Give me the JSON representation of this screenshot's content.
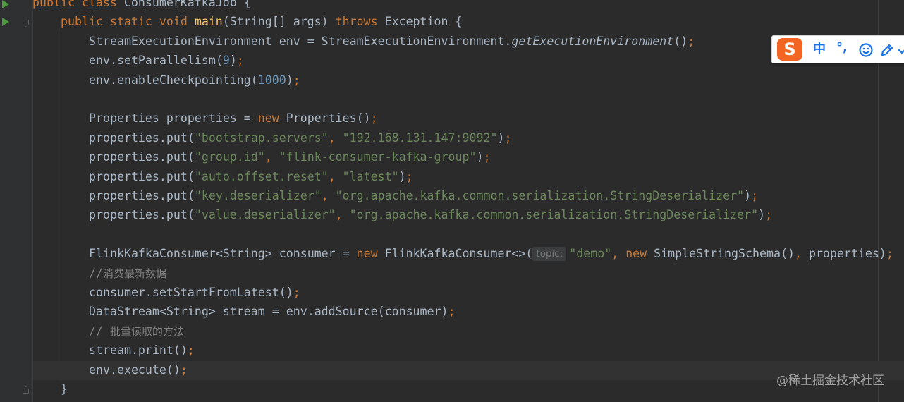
{
  "editor": {
    "lines": [
      {
        "indent": 1,
        "tokens": [
          {
            "t": "public class ",
            "c": "kw"
          },
          {
            "t": "ConsumerKafkaJob {",
            "c": ""
          }
        ]
      },
      {
        "indent": 2,
        "tokens": [
          {
            "t": "public static void ",
            "c": "kw"
          },
          {
            "t": "main",
            "c": "fn"
          },
          {
            "t": "(String[] args) ",
            "c": ""
          },
          {
            "t": "throws ",
            "c": "kw"
          },
          {
            "t": "Exception {",
            "c": ""
          }
        ]
      },
      {
        "indent": 3,
        "tokens": [
          {
            "t": "StreamExecutionEnvironment env = StreamExecutionEnvironment.",
            "c": ""
          },
          {
            "t": "getExecutionEnvironment",
            "c": "it"
          },
          {
            "t": "()",
            "c": ""
          },
          {
            "t": ";",
            "c": "kw"
          }
        ]
      },
      {
        "indent": 3,
        "tokens": [
          {
            "t": "env.setParallelism(",
            "c": ""
          },
          {
            "t": "9",
            "c": "num"
          },
          {
            "t": ")",
            "c": ""
          },
          {
            "t": ";",
            "c": "kw"
          }
        ]
      },
      {
        "indent": 3,
        "tokens": [
          {
            "t": "env.enableCheckpointing(",
            "c": ""
          },
          {
            "t": "1000",
            "c": "num"
          },
          {
            "t": ")",
            "c": ""
          },
          {
            "t": ";",
            "c": "kw"
          }
        ]
      },
      {
        "indent": 3,
        "tokens": []
      },
      {
        "indent": 3,
        "tokens": [
          {
            "t": "Properties properties = ",
            "c": ""
          },
          {
            "t": "new ",
            "c": "kw"
          },
          {
            "t": "Properties()",
            "c": ""
          },
          {
            "t": ";",
            "c": "kw"
          }
        ]
      },
      {
        "indent": 3,
        "tokens": [
          {
            "t": "properties.put(",
            "c": ""
          },
          {
            "t": "\"bootstrap.servers\"",
            "c": "str"
          },
          {
            "t": ", ",
            "c": "kw"
          },
          {
            "t": "\"192.168.131.147:9092\"",
            "c": "str"
          },
          {
            "t": ")",
            "c": ""
          },
          {
            "t": ";",
            "c": "kw"
          }
        ]
      },
      {
        "indent": 3,
        "tokens": [
          {
            "t": "properties.put(",
            "c": ""
          },
          {
            "t": "\"group.id\"",
            "c": "str"
          },
          {
            "t": ", ",
            "c": "kw"
          },
          {
            "t": "\"flink-consumer-kafka-group\"",
            "c": "str"
          },
          {
            "t": ")",
            "c": ""
          },
          {
            "t": ";",
            "c": "kw"
          }
        ]
      },
      {
        "indent": 3,
        "tokens": [
          {
            "t": "properties.put(",
            "c": ""
          },
          {
            "t": "\"auto.offset.reset\"",
            "c": "str"
          },
          {
            "t": ", ",
            "c": "kw"
          },
          {
            "t": "\"latest\"",
            "c": "str"
          },
          {
            "t": ")",
            "c": ""
          },
          {
            "t": ";",
            "c": "kw"
          }
        ]
      },
      {
        "indent": 3,
        "tokens": [
          {
            "t": "properties.put(",
            "c": ""
          },
          {
            "t": "\"key.deserializer\"",
            "c": "str"
          },
          {
            "t": ", ",
            "c": "kw"
          },
          {
            "t": "\"org.apache.kafka.common.serialization.StringDeserializer\"",
            "c": "str"
          },
          {
            "t": ")",
            "c": ""
          },
          {
            "t": ";",
            "c": "kw"
          }
        ]
      },
      {
        "indent": 3,
        "tokens": [
          {
            "t": "properties.put(",
            "c": ""
          },
          {
            "t": "\"value.deserializer\"",
            "c": "str"
          },
          {
            "t": ", ",
            "c": "kw"
          },
          {
            "t": "\"org.apache.kafka.common.serialization.StringDeserializer\"",
            "c": "str"
          },
          {
            "t": ")",
            "c": ""
          },
          {
            "t": ";",
            "c": "kw"
          }
        ]
      },
      {
        "indent": 3,
        "tokens": []
      },
      {
        "indent": 3,
        "tokens": [
          {
            "t": "FlinkKafkaConsumer<String> consumer = ",
            "c": ""
          },
          {
            "t": "new ",
            "c": "kw"
          },
          {
            "t": "FlinkKafkaConsumer<>(",
            "c": ""
          },
          {
            "t": "topic:",
            "c": "hint"
          },
          {
            "t": "\"demo\"",
            "c": "str"
          },
          {
            "t": ", ",
            "c": "kw"
          },
          {
            "t": "new ",
            "c": "kw"
          },
          {
            "t": "SimpleStringSchema()",
            "c": ""
          },
          {
            "t": ", ",
            "c": "kw"
          },
          {
            "t": "properties)",
            "c": ""
          },
          {
            "t": ";",
            "c": "kw"
          }
        ]
      },
      {
        "indent": 3,
        "tokens": [
          {
            "t": "//",
            "c": "cmt"
          },
          {
            "t": "消费最新数据",
            "c": "cmt-cn"
          }
        ]
      },
      {
        "indent": 3,
        "tokens": [
          {
            "t": "consumer.setStartFromLatest()",
            "c": ""
          },
          {
            "t": ";",
            "c": "kw"
          }
        ]
      },
      {
        "indent": 3,
        "tokens": [
          {
            "t": "DataStream<String> stream = env.addSource(consumer)",
            "c": ""
          },
          {
            "t": ";",
            "c": "kw"
          }
        ]
      },
      {
        "indent": 3,
        "tokens": [
          {
            "t": "// ",
            "c": "cmt"
          },
          {
            "t": "批量读取的方法",
            "c": "cmt-cn"
          }
        ]
      },
      {
        "indent": 3,
        "tokens": [
          {
            "t": "stream.print()",
            "c": ""
          },
          {
            "t": ";",
            "c": "kw"
          }
        ]
      },
      {
        "indent": 3,
        "tokens": [
          {
            "t": "env.execute()",
            "c": ""
          },
          {
            "t": ";",
            "c": "kw"
          }
        ]
      },
      {
        "indent": 2,
        "tokens": [
          {
            "t": "}",
            "c": ""
          }
        ]
      }
    ]
  },
  "ime_toolbar": {
    "logo": "S",
    "mode_label": "中",
    "punctuation": "°,",
    "icons": [
      "emoji-icon",
      "pen-icon",
      "more-icon"
    ]
  },
  "colors": {
    "background": "#2b2b2b",
    "keyword": "#cc7832",
    "string": "#6a8759",
    "number": "#6897bb",
    "method": "#ffc66d",
    "text": "#a9b7c6",
    "comment": "#808080",
    "run_icon": "#4e9a3f"
  },
  "watermark": "@稀土掘金技术社区"
}
